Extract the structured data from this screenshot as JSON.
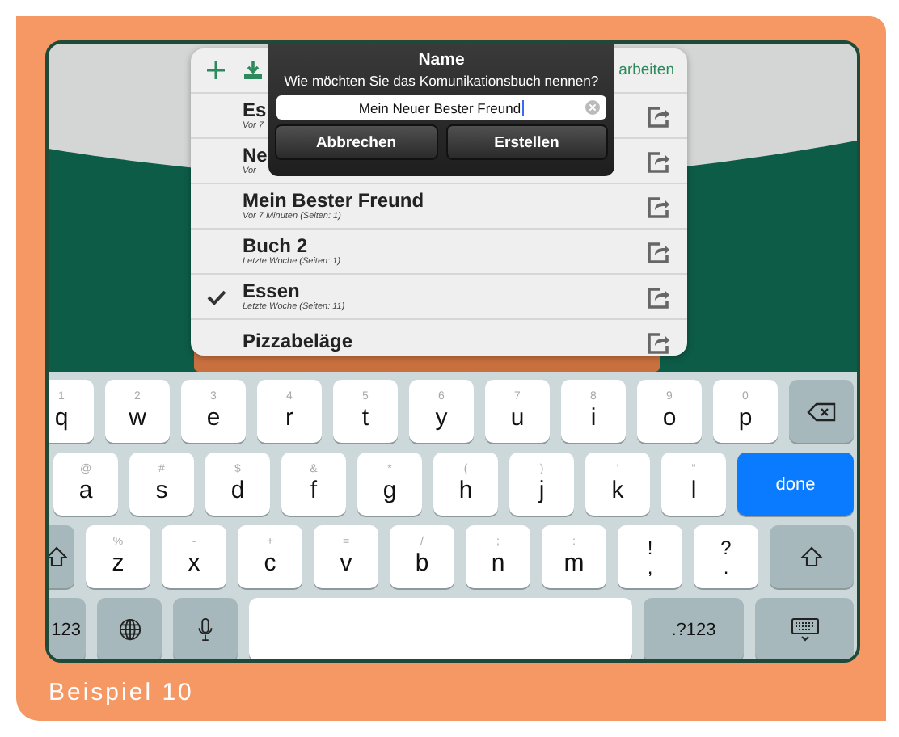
{
  "toolbar": {
    "action_label": "arbeiten"
  },
  "books": [
    {
      "title": "Es",
      "subtitle": "Vor 7",
      "checked": false
    },
    {
      "title": "Ne",
      "subtitle": "Vor",
      "checked": false
    },
    {
      "title": "Mein Bester Freund",
      "subtitle": "Vor 7 Minuten (Seiten: 1)",
      "checked": false
    },
    {
      "title": "Buch 2",
      "subtitle": "Letzte Woche (Seiten: 1)",
      "checked": false
    },
    {
      "title": "Essen",
      "subtitle": "Letzte Woche (Seiten: 11)",
      "checked": true
    },
    {
      "title": "Pizzabeläge",
      "checked": false
    }
  ],
  "dialog": {
    "title": "Name",
    "message": "Wie möchten Sie das Komunikationsbuch nennen?",
    "value": "Mein Neuer Bester Freund",
    "buttons": [
      "Abbrechen",
      "Erstellen"
    ]
  },
  "keyboard": {
    "rows": [
      [
        {
          "kind": "letter",
          "label": "q",
          "hint": "1"
        },
        {
          "kind": "letter",
          "label": "w",
          "hint": "2"
        },
        {
          "kind": "letter",
          "label": "e",
          "hint": "3"
        },
        {
          "kind": "letter",
          "label": "r",
          "hint": "4"
        },
        {
          "kind": "letter",
          "label": "t",
          "hint": "5"
        },
        {
          "kind": "letter",
          "label": "y",
          "hint": "6"
        },
        {
          "kind": "letter",
          "label": "u",
          "hint": "7"
        },
        {
          "kind": "letter",
          "label": "i",
          "hint": "8"
        },
        {
          "kind": "letter",
          "label": "o",
          "hint": "9"
        },
        {
          "kind": "letter",
          "label": "p",
          "hint": "0"
        },
        {
          "kind": "backspace"
        }
      ],
      [
        {
          "kind": "letter",
          "label": "a",
          "hint": "@"
        },
        {
          "kind": "letter",
          "label": "s",
          "hint": "#"
        },
        {
          "kind": "letter",
          "label": "d",
          "hint": "$"
        },
        {
          "kind": "letter",
          "label": "f",
          "hint": "&"
        },
        {
          "kind": "letter",
          "label": "g",
          "hint": "*"
        },
        {
          "kind": "letter",
          "label": "h",
          "hint": "("
        },
        {
          "kind": "letter",
          "label": "j",
          "hint": ")"
        },
        {
          "kind": "letter",
          "label": "k",
          "hint": "'"
        },
        {
          "kind": "letter",
          "label": "l",
          "hint": "\""
        },
        {
          "kind": "done",
          "label": "done"
        }
      ],
      [
        {
          "kind": "shift"
        },
        {
          "kind": "letter",
          "label": "z",
          "hint": "%"
        },
        {
          "kind": "letter",
          "label": "x",
          "hint": "-"
        },
        {
          "kind": "letter",
          "label": "c",
          "hint": "+"
        },
        {
          "kind": "letter",
          "label": "v",
          "hint": "="
        },
        {
          "kind": "letter",
          "label": "b",
          "hint": "/"
        },
        {
          "kind": "letter",
          "label": "n",
          "hint": ";"
        },
        {
          "kind": "letter",
          "label": "m",
          "hint": ":"
        },
        {
          "kind": "punct",
          "label": ",",
          "hint": "!"
        },
        {
          "kind": "punct",
          "label": ".",
          "hint": "?"
        },
        {
          "kind": "shift"
        }
      ],
      [
        {
          "kind": "mod",
          "label": "123"
        },
        {
          "kind": "globe"
        },
        {
          "kind": "mic"
        },
        {
          "kind": "space"
        },
        {
          "kind": "mod",
          "label": ".?123"
        },
        {
          "kind": "hide"
        }
      ]
    ]
  },
  "caption": "Beispiel 10"
}
